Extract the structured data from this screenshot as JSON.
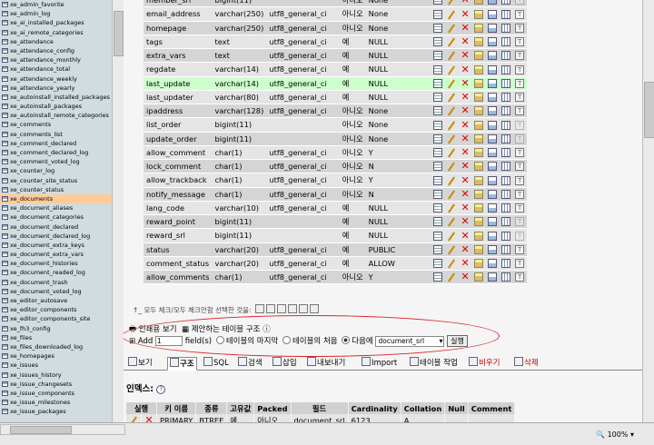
{
  "left_nav": {
    "items": [
      "xe_admin_favorite",
      "xe_admin_log",
      "xe_ai_installed_packages",
      "xe_ai_remote_categories",
      "xe_attendance",
      "xe_attendance_config",
      "xe_attendance_monthly",
      "xe_attendance_total",
      "xe_attendance_weekly",
      "xe_attendance_yearly",
      "xe_autoinstall_installed_packages",
      "xe_autoinstall_packages",
      "xe_autoinstall_remote_categories",
      "xe_comments",
      "xe_comments_list",
      "xe_comment_declared",
      "xe_comment_declared_log",
      "xe_comment_voted_log",
      "xe_counter_log",
      "xe_counter_site_status",
      "xe_counter_status",
      "xe_documents",
      "xe_document_aliases",
      "xe_document_categories",
      "xe_document_declared",
      "xe_document_declared_log",
      "xe_document_extra_keys",
      "xe_document_extra_vars",
      "xe_document_histories",
      "xe_document_readed_log",
      "xe_document_trash",
      "xe_document_voted_log",
      "xe_editor_autosave",
      "xe_editor_components",
      "xe_editor_components_site",
      "xe_fh3_config",
      "xe_files",
      "xe_files_downloaded_log",
      "xe_homepages",
      "xe_issues",
      "xe_issues_history",
      "xe_issue_changesets",
      "xe_issue_components",
      "xe_issue_milestones",
      "xe_issue_packages"
    ],
    "active": "xe_documents"
  },
  "fields": [
    {
      "name": "member_srl",
      "type": "bigint(11)",
      "collation": "",
      "null": "아니오",
      "default": "None"
    },
    {
      "name": "email_address",
      "type": "varchar(250)",
      "collation": "utf8_general_ci",
      "null": "아니오",
      "default": "None"
    },
    {
      "name": "homepage",
      "type": "varchar(250)",
      "collation": "utf8_general_ci",
      "null": "아니오",
      "default": "None"
    },
    {
      "name": "tags",
      "type": "text",
      "collation": "utf8_general_ci",
      "null": "예",
      "default": "NULL"
    },
    {
      "name": "extra_vars",
      "type": "text",
      "collation": "utf8_general_ci",
      "null": "예",
      "default": "NULL"
    },
    {
      "name": "regdate",
      "type": "varchar(14)",
      "collation": "utf8_general_ci",
      "null": "예",
      "default": "NULL"
    },
    {
      "name": "last_update",
      "type": "varchar(14)",
      "collation": "utf8_general_ci",
      "null": "예",
      "default": "NULL"
    },
    {
      "name": "last_updater",
      "type": "varchar(80)",
      "collation": "utf8_general_ci",
      "null": "예",
      "default": "NULL"
    },
    {
      "name": "ipaddress",
      "type": "varchar(128)",
      "collation": "utf8_general_ci",
      "null": "아니오",
      "default": "None"
    },
    {
      "name": "list_order",
      "type": "bigint(11)",
      "collation": "",
      "null": "아니오",
      "default": "None"
    },
    {
      "name": "update_order",
      "type": "bigint(11)",
      "collation": "",
      "null": "아니오",
      "default": "None"
    },
    {
      "name": "allow_comment",
      "type": "char(1)",
      "collation": "utf8_general_ci",
      "null": "아니오",
      "default": "Y"
    },
    {
      "name": "lock_comment",
      "type": "char(1)",
      "collation": "utf8_general_ci",
      "null": "아니오",
      "default": "N"
    },
    {
      "name": "allow_trackback",
      "type": "char(1)",
      "collation": "utf8_general_ci",
      "null": "아니오",
      "default": "Y"
    },
    {
      "name": "notify_message",
      "type": "char(1)",
      "collation": "utf8_general_ci",
      "null": "아니오",
      "default": "N"
    },
    {
      "name": "lang_code",
      "type": "varchar(10)",
      "collation": "utf8_general_ci",
      "null": "예",
      "default": "NULL"
    },
    {
      "name": "reward_point",
      "type": "bigint(11)",
      "collation": "",
      "null": "예",
      "default": "NULL"
    },
    {
      "name": "reward_srl",
      "type": "bigint(11)",
      "collation": "",
      "null": "예",
      "default": "NULL"
    },
    {
      "name": "status",
      "type": "varchar(20)",
      "collation": "utf8_general_ci",
      "null": "예",
      "default": "PUBLIC"
    },
    {
      "name": "comment_status",
      "type": "varchar(20)",
      "collation": "utf8_general_ci",
      "null": "예",
      "default": "ALLOW"
    },
    {
      "name": "allow_comments",
      "type": "char(1)",
      "collation": "utf8_general_ci",
      "null": "아니오",
      "default": "Y"
    }
  ],
  "highlighted_field": "last_update",
  "check_all": {
    "label": "모두 체크/모두 체크안함 선택한 것을:"
  },
  "print_row": {
    "print_view": "인쇄용 보기",
    "propose": "제안하는 테이블 구조"
  },
  "add_row": {
    "add_label": "Add",
    "count": "1",
    "fields_label": "field(s)",
    "opt_end": "테이블의 마지막",
    "opt_start": "테이블의 처음",
    "opt_after": "다음에",
    "after_field": "document_srl",
    "go": "실행"
  },
  "tabs": [
    {
      "label": "보기",
      "active": false,
      "red": false
    },
    {
      "label": "구조",
      "active": true,
      "red": false
    },
    {
      "label": "SQL",
      "active": false,
      "red": false
    },
    {
      "label": "검색",
      "active": false,
      "red": false
    },
    {
      "label": "삽입",
      "active": false,
      "red": false
    },
    {
      "label": "내보내기",
      "active": false,
      "red": false
    },
    {
      "label": "Import",
      "active": false,
      "red": false
    },
    {
      "label": "테이블 작업",
      "active": false,
      "red": false
    },
    {
      "label": "비우기",
      "active": false,
      "red": true
    },
    {
      "label": "삭제",
      "active": false,
      "red": true
    }
  ],
  "index": {
    "title": "인덱스:",
    "headers": [
      "실행",
      "키 이름",
      "종류",
      "고유값",
      "Packed",
      "필드",
      "Cardinality",
      "Collation",
      "Null",
      "Comment"
    ],
    "rows": [
      [
        "",
        "PRIMARY",
        "BTREE",
        "예",
        "아니오",
        "document_srl",
        "6123",
        "A",
        "",
        ""
      ]
    ]
  },
  "status": {
    "zoom": "100%"
  }
}
